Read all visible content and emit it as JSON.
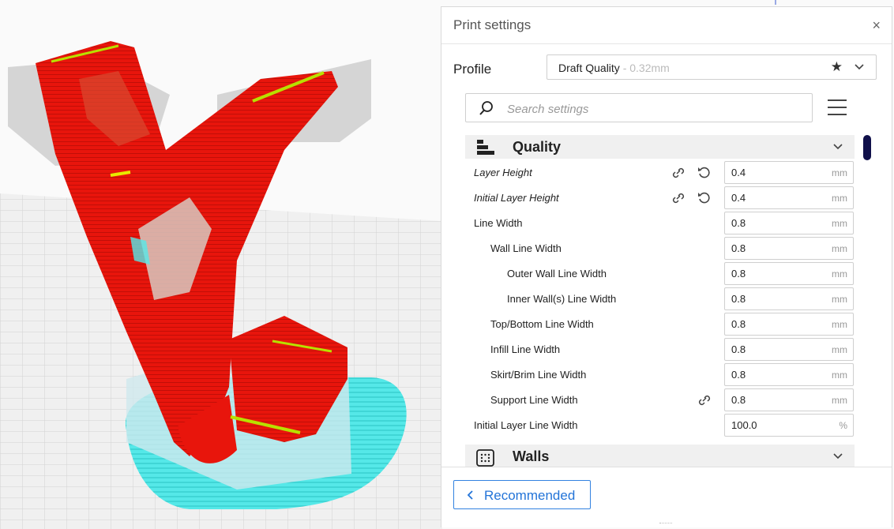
{
  "viewport": {
    "description": ""
  },
  "panel": {
    "title": "Print settings",
    "close_label": "×",
    "profile_label": "Profile",
    "profile_name": "Draft Quality",
    "profile_variant": " - 0.32mm",
    "search_placeholder": "Search settings"
  },
  "categories": {
    "quality": "Quality",
    "walls": "Walls"
  },
  "settings": [
    {
      "label": "Layer Height",
      "value": "0.4",
      "unit": "mm"
    },
    {
      "label": "Initial Layer Height",
      "value": "0.4",
      "unit": "mm"
    },
    {
      "label": "Line Width",
      "value": "0.8",
      "unit": "mm"
    },
    {
      "label": "Wall Line Width",
      "value": "0.8",
      "unit": "mm"
    },
    {
      "label": "Outer Wall Line Width",
      "value": "0.8",
      "unit": "mm"
    },
    {
      "label": "Inner Wall(s) Line Width",
      "value": "0.8",
      "unit": "mm"
    },
    {
      "label": "Top/Bottom Line Width",
      "value": "0.8",
      "unit": "mm"
    },
    {
      "label": "Infill Line Width",
      "value": "0.8",
      "unit": "mm"
    },
    {
      "label": "Skirt/Brim Line Width",
      "value": "0.8",
      "unit": "mm"
    },
    {
      "label": "Support Line Width",
      "value": "0.8",
      "unit": "mm"
    },
    {
      "label": "Initial Layer Line Width",
      "value": "100.0",
      "unit": "%"
    }
  ],
  "footer": {
    "recommended_label": "Recommended"
  },
  "colors": {
    "model_red": "#e8150c",
    "brim_cyan": "#55e8e8",
    "accent_blue": "#2374d8",
    "scrollbar": "#10104a"
  }
}
